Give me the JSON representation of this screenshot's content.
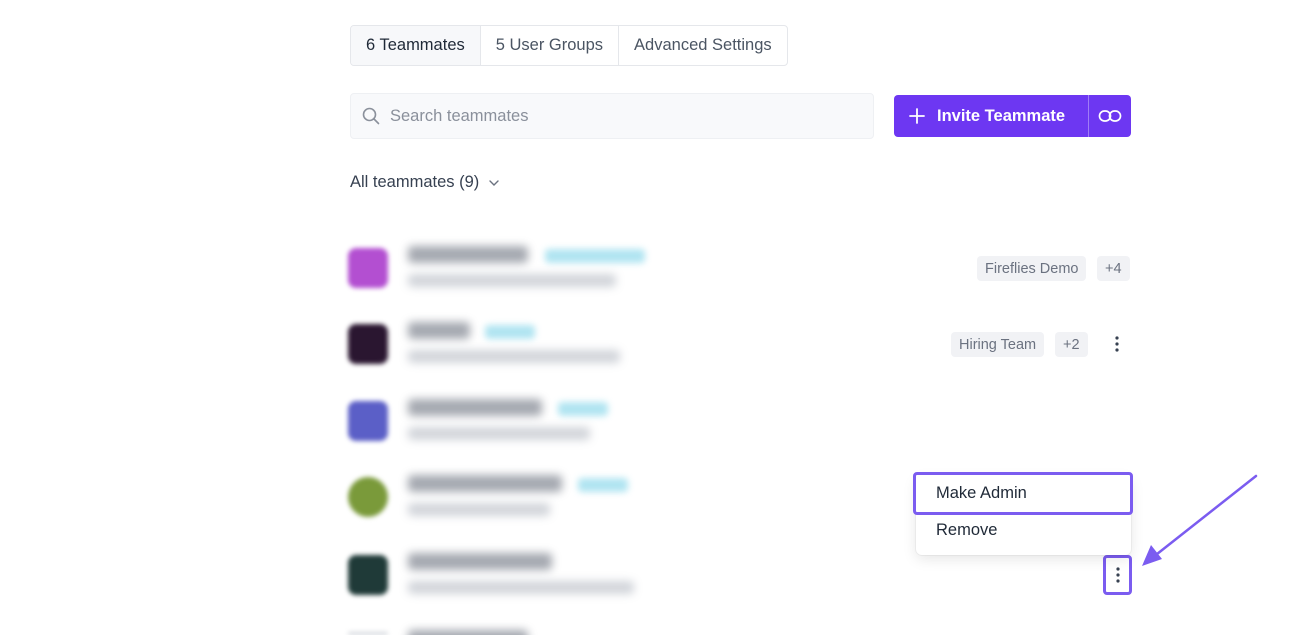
{
  "tabs": [
    {
      "label": "6 Teammates",
      "active": true
    },
    {
      "label": "5 User Groups",
      "active": false
    },
    {
      "label": "Advanced Settings",
      "active": false
    }
  ],
  "search": {
    "placeholder": "Search teammates"
  },
  "invite": {
    "label": "Invite Teammate"
  },
  "filter": {
    "label": "All teammates (9)"
  },
  "rows": [
    {
      "tags": [
        "Fireflies Demo",
        "+4"
      ]
    },
    {
      "tags": [
        "Hiring Team",
        "+2"
      ]
    }
  ],
  "menu": {
    "items": [
      "Make Admin",
      "Remove"
    ]
  },
  "colors": {
    "accent": "#6d37f2",
    "highlight": "#7b5cf0"
  }
}
